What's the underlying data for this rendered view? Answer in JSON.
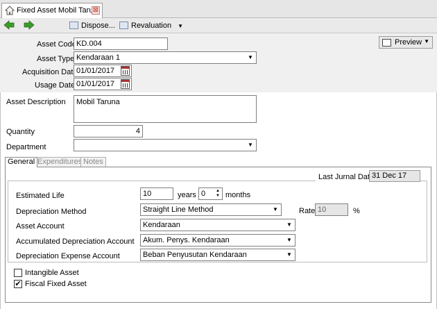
{
  "window": {
    "tab_title": "Fixed Asset Mobil Taru...",
    "tab_close": "⊠"
  },
  "toolbar": {
    "back_icon": "➜",
    "forward_icon": "➜",
    "dispose_label": "Dispose...",
    "revaluation_label": "Revaluation",
    "revaluation_dropdown": "▼"
  },
  "header": {
    "asset_code_label": "Asset Code",
    "asset_code_value": "KD.004",
    "asset_type_label": "Asset Type",
    "asset_type_value": "Kendaraan 1",
    "acquisition_date_label": "Acquisition Date",
    "acquisition_date_value": "01/01/2017",
    "usage_date_label": "Usage Date",
    "usage_date_value": "01/01/2017",
    "preview_label": "Preview",
    "preview_dropdown": "▼"
  },
  "details": {
    "description_label": "Asset Description",
    "description_value": "Mobil Taruna",
    "quantity_label": "Quantity",
    "quantity_value": "4",
    "department_label": "Department",
    "department_value": ""
  },
  "tabs": [
    {
      "label": "General",
      "active": true
    },
    {
      "label": "Expenditures",
      "active": false
    },
    {
      "label": "Notes",
      "active": false
    }
  ],
  "general": {
    "last_jurnal_label": "Last Jurnal Date",
    "last_jurnal_value": "31 Dec 17",
    "estimated_life_label": "Estimated Life",
    "estimated_life_years": "10",
    "years_label": "years",
    "estimated_life_months": "0",
    "months_label": "months",
    "depreciation_method_label": "Depreciation Method",
    "depreciation_method_value": "Straight Line Method",
    "rate_label": "Rate",
    "rate_value": "10",
    "rate_unit": "%",
    "asset_account_label": "Asset Account",
    "asset_account_value": "Kendaraan",
    "accum_depr_label": "Accumulated Depreciation Account",
    "accum_depr_value": "Akum. Penys. Kendaraan",
    "depr_expense_label": "Depreciation Expense Account",
    "depr_expense_value": "Beban Penyusutan Kendaraan",
    "intangible_label": "Intangible Asset",
    "intangible_checked": false,
    "fiscal_label": "Fiscal Fixed Asset",
    "fiscal_checked": true,
    "check_mark": "✔"
  },
  "colors": {
    "nav_arrow": "#3a9a2a",
    "header_bg": "#f0f0f0",
    "readonly_bg": "#e6e6e6"
  }
}
